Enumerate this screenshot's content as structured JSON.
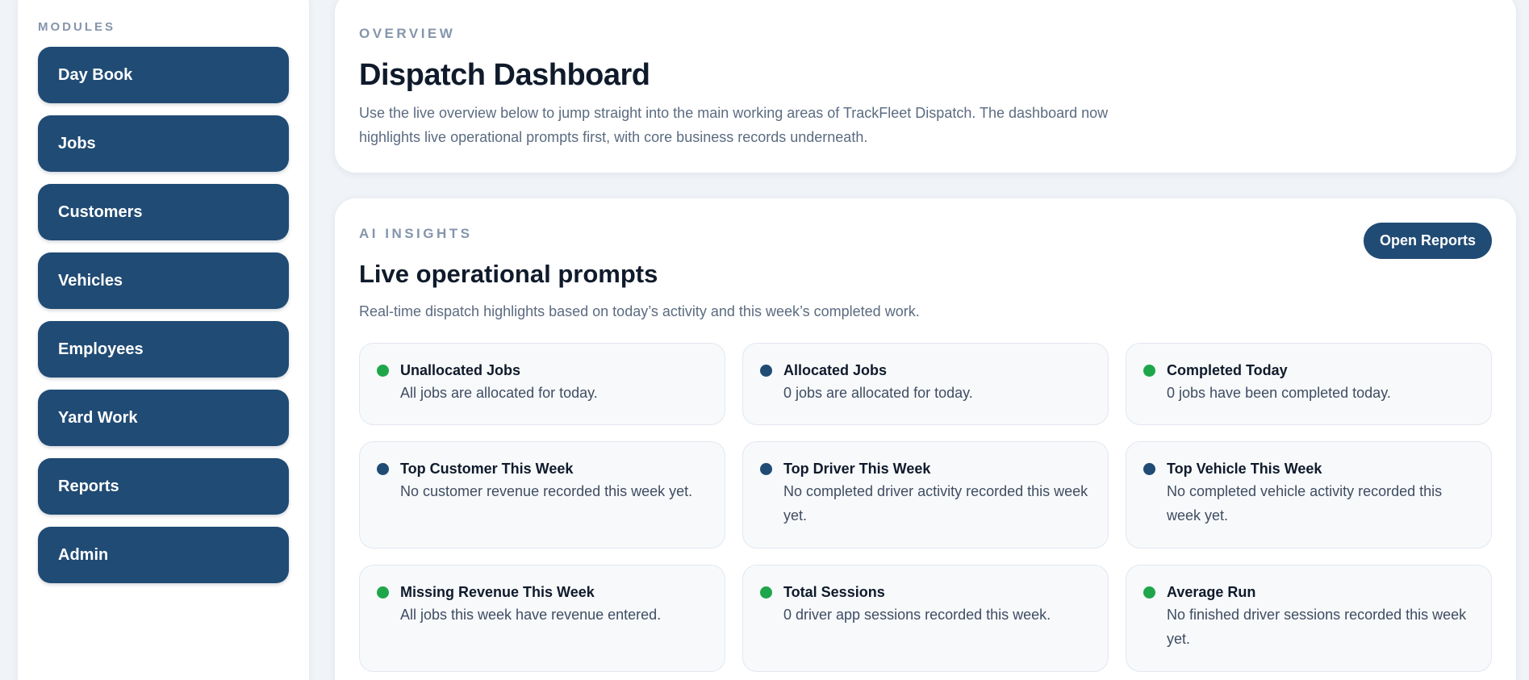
{
  "sidebar": {
    "title": "MODULES",
    "items": [
      {
        "label": "Day Book"
      },
      {
        "label": "Jobs"
      },
      {
        "label": "Customers"
      },
      {
        "label": "Vehicles"
      },
      {
        "label": "Employees"
      },
      {
        "label": "Yard Work"
      },
      {
        "label": "Reports"
      },
      {
        "label": "Admin"
      }
    ]
  },
  "overview": {
    "eyebrow": "OVERVIEW",
    "title": "Dispatch Dashboard",
    "description": "Use the live overview below to jump straight into the main working areas of TrackFleet Dispatch. The dashboard now highlights live operational prompts first, with core business records underneath."
  },
  "insights": {
    "eyebrow": "AI INSIGHTS",
    "title": "Live operational prompts",
    "subtitle": "Real-time dispatch highlights based on today’s activity and this week’s completed work.",
    "open_reports_label": "Open Reports",
    "status_colors": {
      "green": "#1fa64a",
      "blue": "#204b74"
    },
    "tiles": [
      {
        "title": "Unallocated Jobs",
        "text": "All jobs are allocated for today.",
        "status": "green"
      },
      {
        "title": "Allocated Jobs",
        "text": "0 jobs are allocated for today.",
        "status": "blue"
      },
      {
        "title": "Completed Today",
        "text": "0 jobs have been completed today.",
        "status": "green"
      },
      {
        "title": "Top Customer This Week",
        "text": "No customer revenue recorded this week yet.",
        "status": "blue"
      },
      {
        "title": "Top Driver This Week",
        "text": "No completed driver activity recorded this week yet.",
        "status": "blue"
      },
      {
        "title": "Top Vehicle This Week",
        "text": "No completed vehicle activity recorded this week yet.",
        "status": "blue"
      },
      {
        "title": "Missing Revenue This Week",
        "text": "All jobs this week have revenue entered.",
        "status": "green"
      },
      {
        "title": "Total Sessions",
        "text": "0 driver app sessions recorded this week.",
        "status": "green"
      },
      {
        "title": "Average Run",
        "text": "No finished driver sessions recorded this week yet.",
        "status": "green"
      }
    ]
  }
}
